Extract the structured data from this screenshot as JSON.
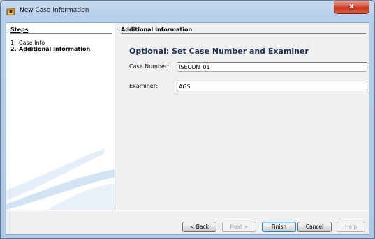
{
  "window": {
    "title": "New Case Information",
    "close_glyph": "x"
  },
  "steps": {
    "title": "Steps",
    "items": [
      {
        "num": "1.",
        "label": "Case Info"
      },
      {
        "num": "2.",
        "label": "Additional Information"
      }
    ]
  },
  "content": {
    "section_title": "Additional Information",
    "heading": "Optional: Set Case Number and Examiner",
    "case_number": {
      "label": "Case Number:",
      "value": "ISECON_01"
    },
    "examiner": {
      "label": "Examiner:",
      "value": "AGS"
    }
  },
  "buttons": {
    "back": "< Back",
    "next": "Next >",
    "finish": "Finish",
    "cancel": "Cancel",
    "help": "Help"
  },
  "icons": {
    "app": "case-folder-icon",
    "close": "close-icon"
  },
  "colors": {
    "heading": "#1b2f55",
    "close_button": "#c63318",
    "window_frame": "#b7cfea"
  }
}
